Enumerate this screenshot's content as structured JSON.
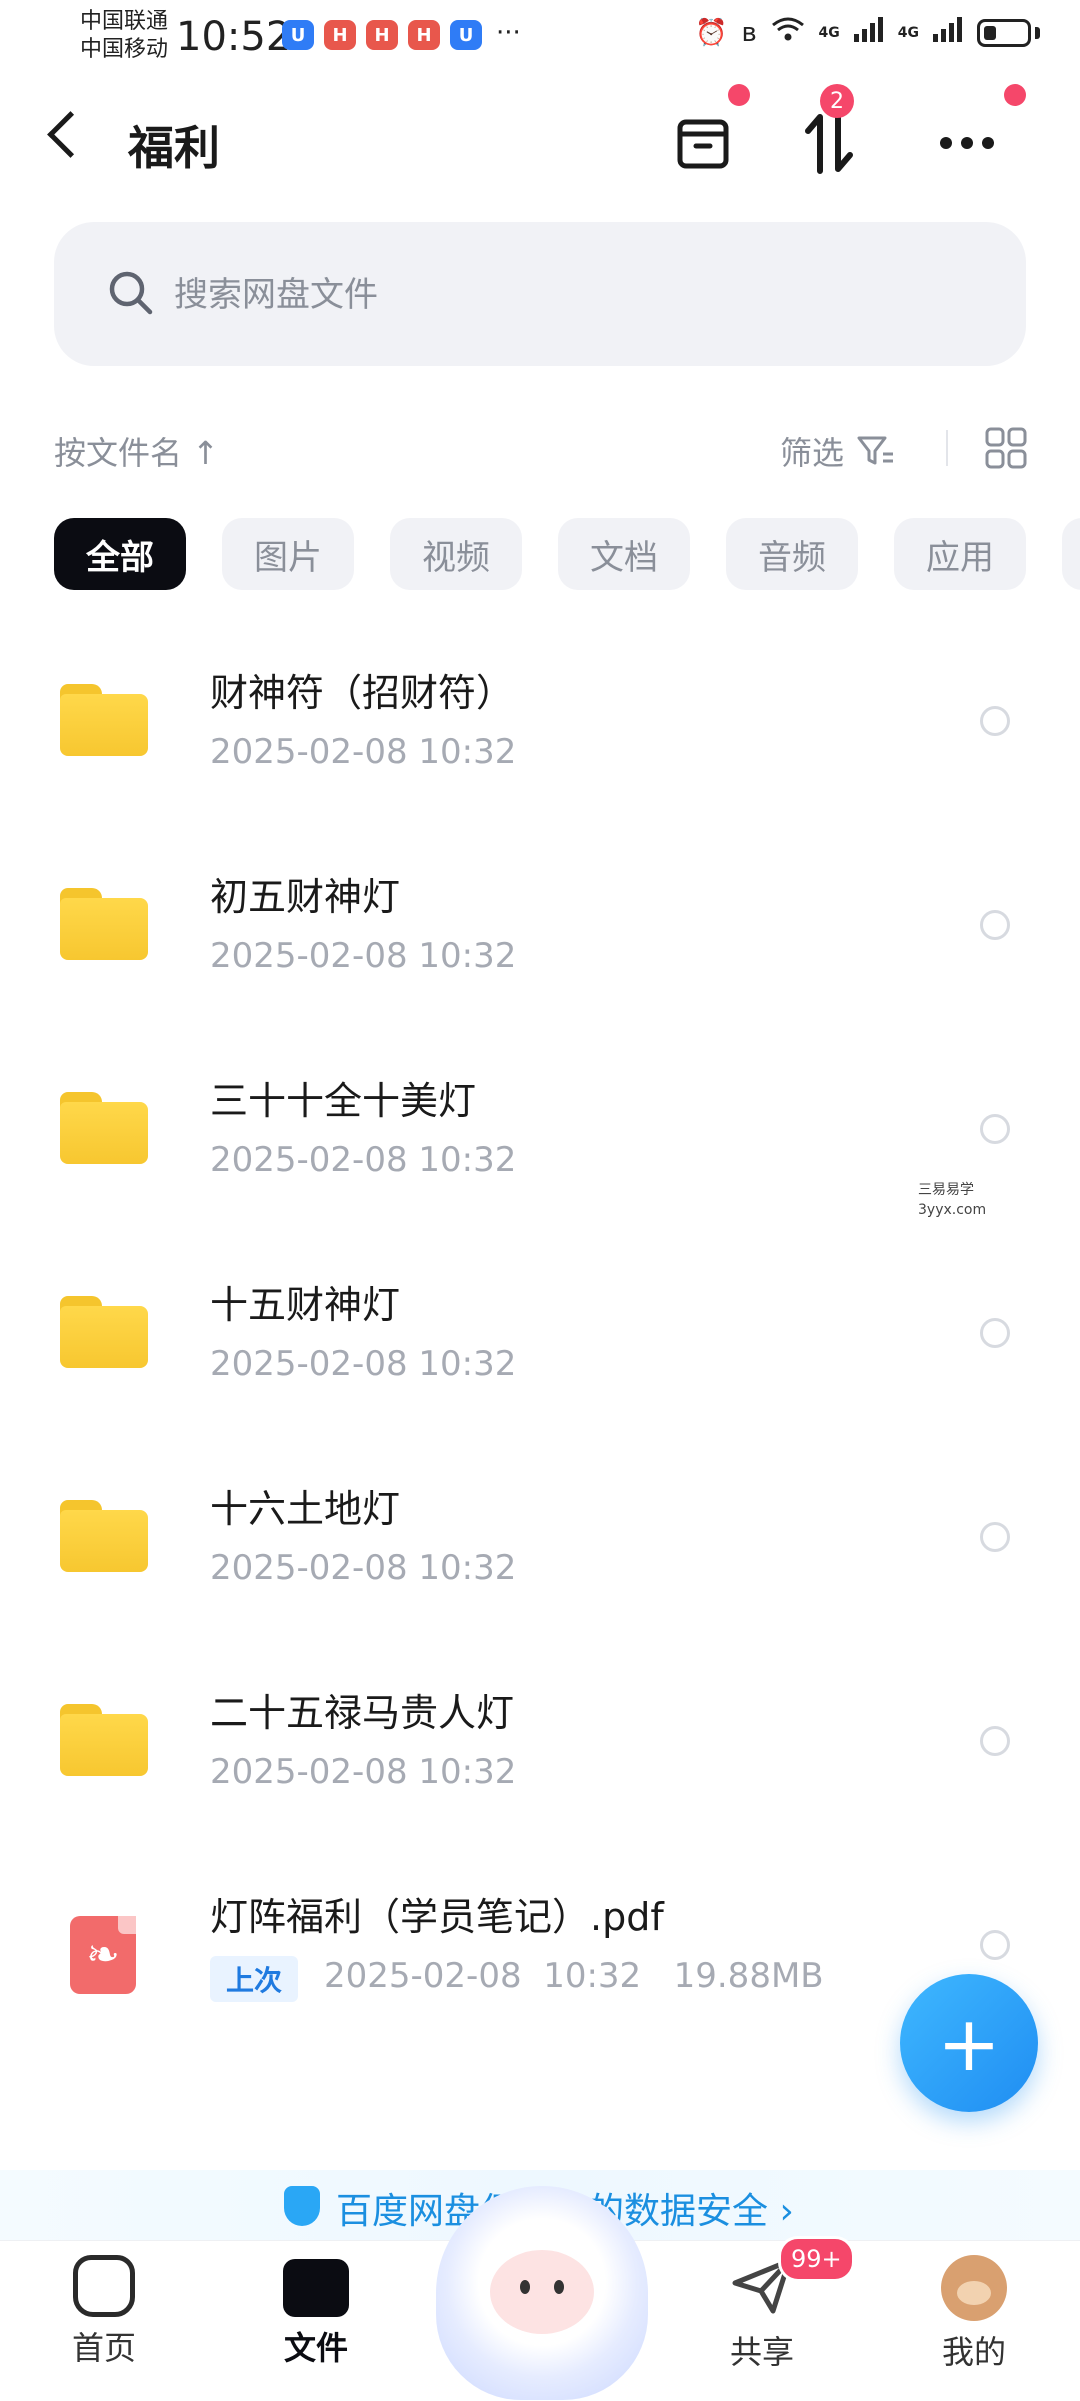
{
  "status_bar": {
    "carrier1": "中国联通",
    "carrier2": "中国移动",
    "time": "10:52",
    "more": "···",
    "net1": "4G",
    "net2": "4G"
  },
  "header": {
    "title": "福利",
    "transfer_badge": "2"
  },
  "search": {
    "placeholder": "搜索网盘文件"
  },
  "sort": {
    "label": "按文件名 ↑",
    "filter_label": "筛选"
  },
  "tabs": [
    "全部",
    "图片",
    "视频",
    "文档",
    "音频",
    "应用"
  ],
  "files": [
    {
      "name": "财神符（招财符）",
      "date": "2025-02-08  10:32"
    },
    {
      "name": "初五财神灯",
      "date": "2025-02-08  10:32"
    },
    {
      "name": "三十十全十美灯",
      "date": "2025-02-08  10:32"
    },
    {
      "name": "十五财神灯",
      "date": "2025-02-08  10:32"
    },
    {
      "name": "十六土地灯",
      "date": "2025-02-08  10:32"
    },
    {
      "name": "二十五禄马贵人灯",
      "date": "2025-02-08  10:32"
    }
  ],
  "pdf": {
    "name": "灯阵福利（学员笔记）.pdf",
    "tag": "上次",
    "meta": "2025-02-08  10:32   19.88MB"
  },
  "fab": {
    "label": "+"
  },
  "watermark": {
    "line1": "三易易学",
    "line2": "3yyx.com"
  },
  "banner": {
    "text": "百度网盘保护您的数据安全 ›"
  },
  "bottom_nav": {
    "home": "首页",
    "files": "文件",
    "share": "共享",
    "share_badge": "99+",
    "me": "我的"
  },
  "colors": {
    "accent": "#1f8df2",
    "badge": "#f5476a",
    "folder": "#ffd84a"
  }
}
